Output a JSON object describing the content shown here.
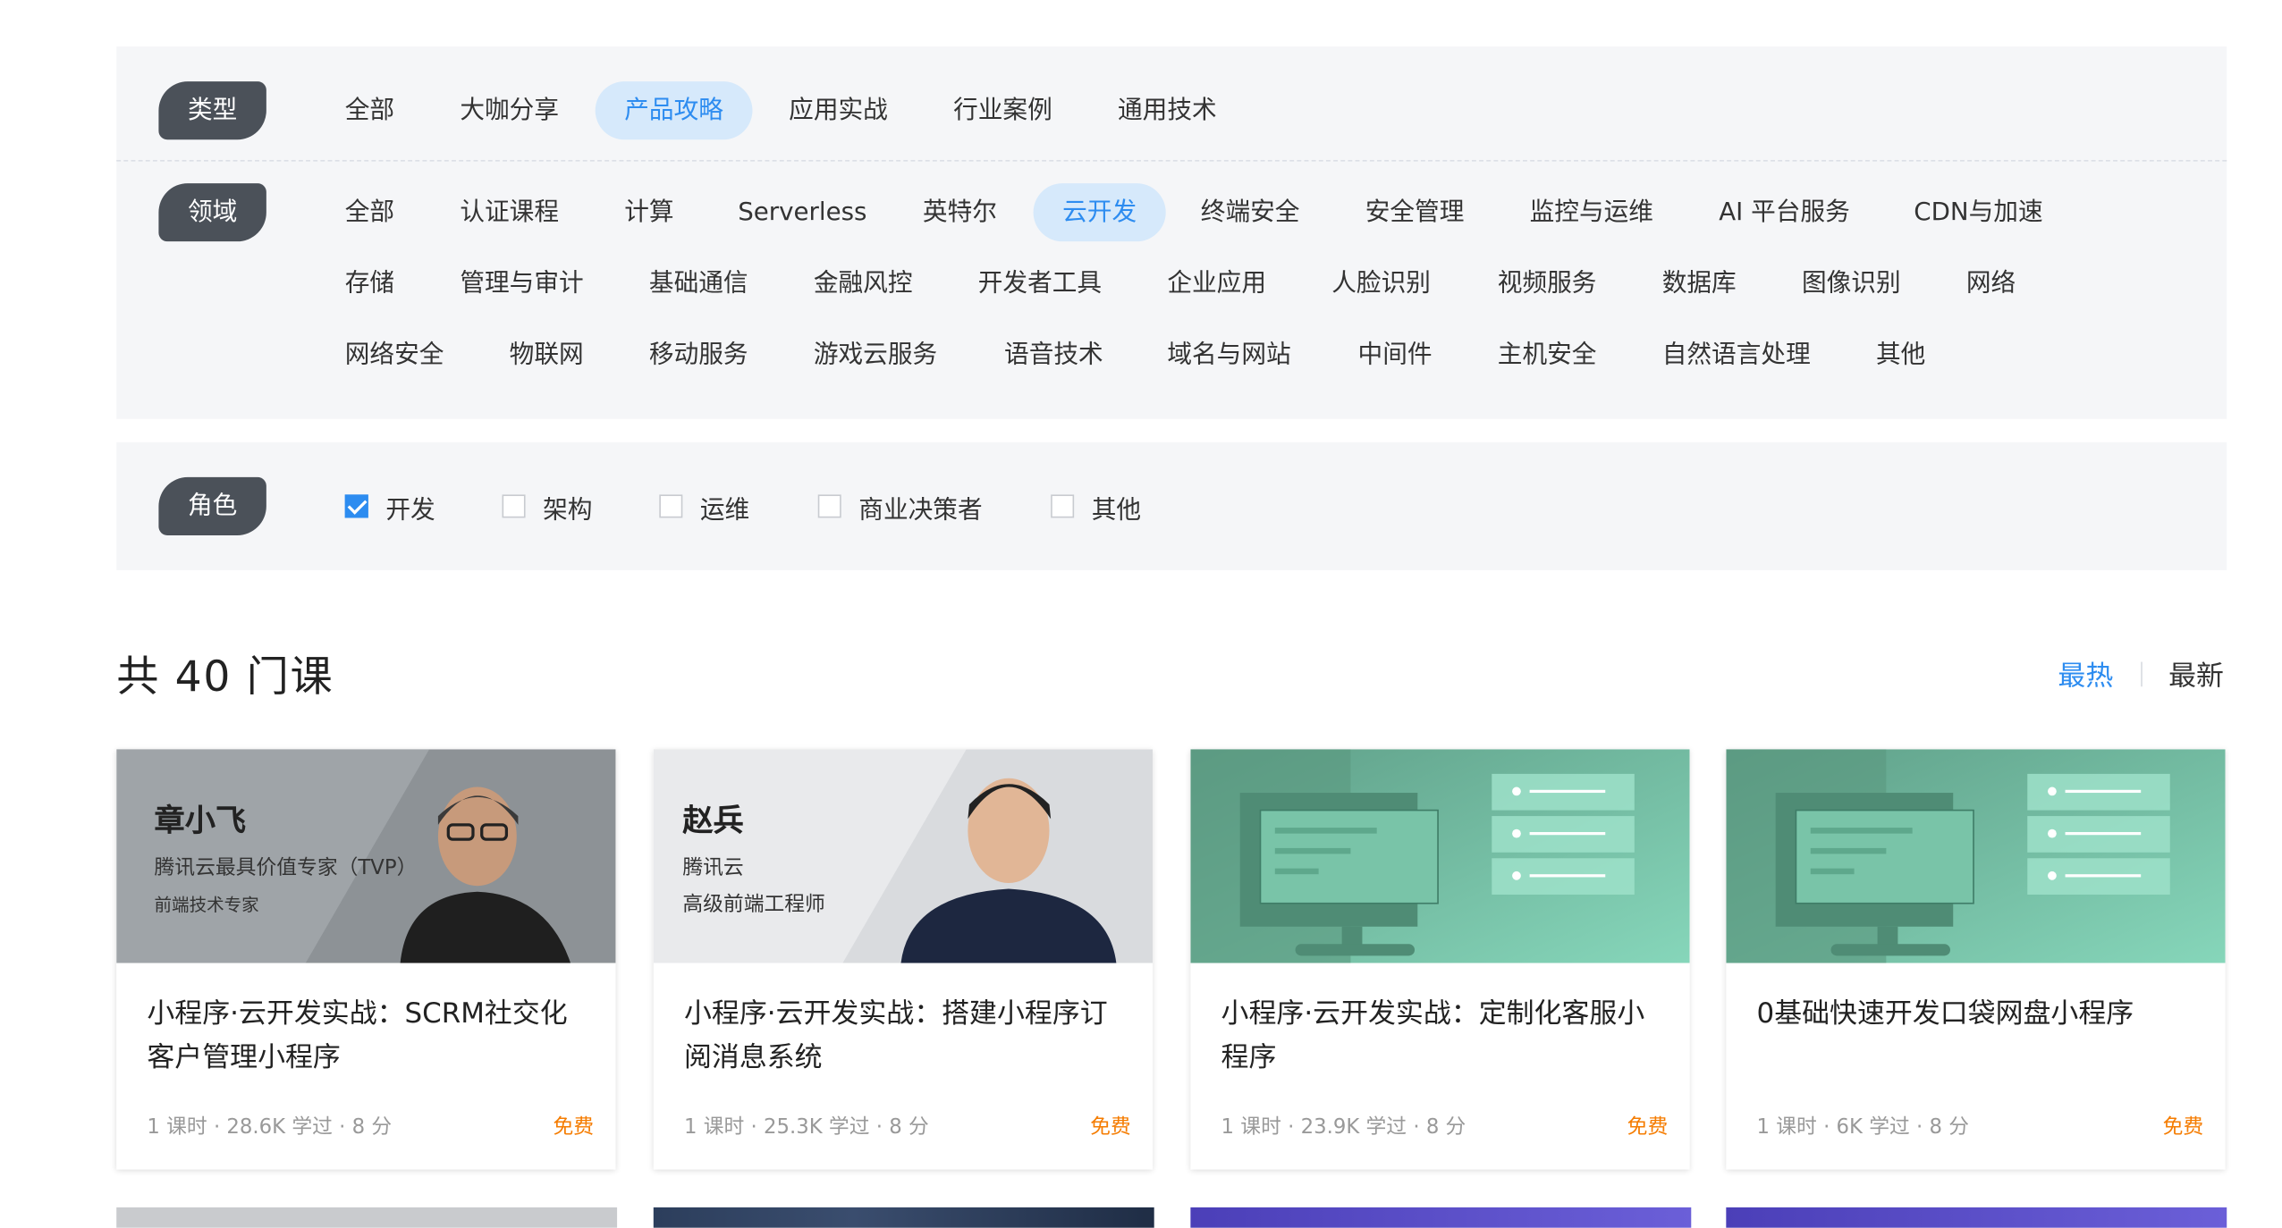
{
  "filters": {
    "type": {
      "label": "类型",
      "options": [
        "全部",
        "大咖分享",
        "产品攻略",
        "应用实战",
        "行业案例",
        "通用技术"
      ],
      "selected": "产品攻略"
    },
    "domain": {
      "label": "领域",
      "options": [
        "全部",
        "认证课程",
        "计算",
        "Serverless",
        "英特尔",
        "云开发",
        "终端安全",
        "安全管理",
        "监控与运维",
        "AI 平台服务",
        "CDN与加速",
        "存储",
        "管理与审计",
        "基础通信",
        "金融风控",
        "开发者工具",
        "企业应用",
        "人脸识别",
        "视频服务",
        "数据库",
        "图像识别",
        "网络",
        "网络安全",
        "物联网",
        "移动服务",
        "游戏云服务",
        "语音技术",
        "域名与网站",
        "中间件",
        "主机安全",
        "自然语言处理",
        "其他"
      ],
      "selected": "云开发"
    },
    "role": {
      "label": "角色",
      "options": [
        {
          "label": "开发",
          "checked": true
        },
        {
          "label": "架构",
          "checked": false
        },
        {
          "label": "运维",
          "checked": false
        },
        {
          "label": "商业决策者",
          "checked": false
        },
        {
          "label": "其他",
          "checked": false
        }
      ]
    }
  },
  "results": {
    "count_text": "共 40 门课",
    "sort": {
      "hot": "最热",
      "new": "最新",
      "active": "hot"
    }
  },
  "colors": {
    "accent": "#2d8cf0",
    "price": "#f57c00",
    "tag_bg": "#4b5159",
    "panel_bg": "#f5f6f8"
  },
  "courses": [
    {
      "title": "小程序·云开发实战：SCRM社交化客户管理小程序",
      "meta": "1 课时 · 28.6K 学过 · 8 分",
      "price": "免费",
      "cover": {
        "kind": "speaker",
        "name": "章小飞",
        "line1": "腾讯云最具价值专家（TVP）",
        "line2": "前端技术专家"
      }
    },
    {
      "title": "小程序·云开发实战：搭建小程序订阅消息系统",
      "meta": "1 课时 · 25.3K 学过 · 8 分",
      "price": "免费",
      "cover": {
        "kind": "speaker",
        "name": "赵兵",
        "line1": "腾讯云",
        "line2": "高级前端工程师"
      }
    },
    {
      "title": "小程序·云开发实战：定制化客服小程序",
      "meta": "1 课时 · 23.9K 学过 · 8 分",
      "price": "免费",
      "cover": {
        "kind": "illustration",
        "icon": "monitor-server-illustration"
      }
    },
    {
      "title": "0基础快速开发口袋网盘小程序",
      "meta": "1 课时 · 6K 学过 · 8 分",
      "price": "免费",
      "cover": {
        "kind": "illustration",
        "icon": "monitor-server-illustration"
      }
    }
  ]
}
